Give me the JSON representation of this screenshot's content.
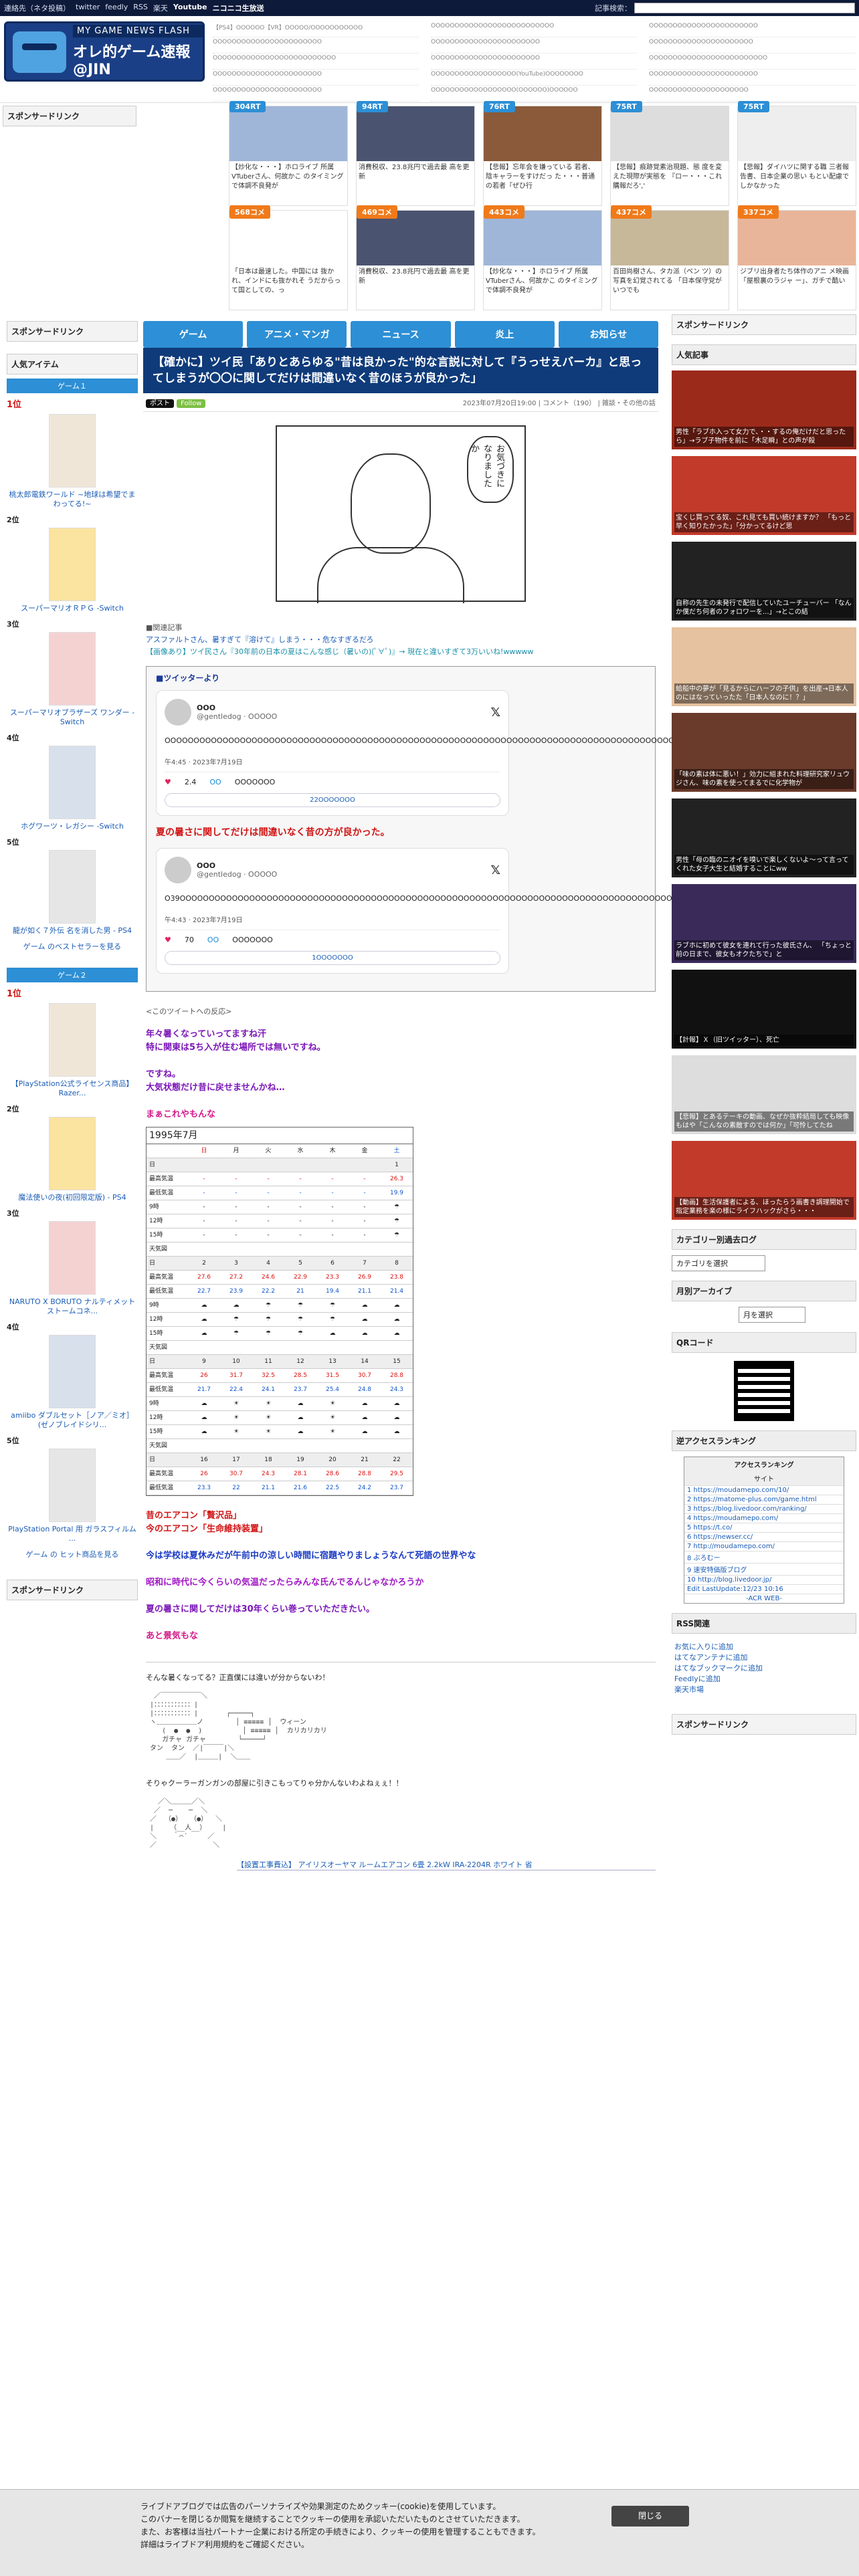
{
  "topbar": {
    "links": [
      "連絡先（ネタ投稿）",
      "twitter",
      "feedly",
      "RSS",
      "楽天",
      "Youtube",
      "ニコニコ生放送"
    ],
    "search_label": "記事検索："
  },
  "logo": {
    "line1": "MY GAME NEWS FLASH",
    "line2": "オレ的ゲーム速報@JIN"
  },
  "header_links": [
    "【PS4】OOOOOO【VR】OOOOO/OOOOOOOOOOO",
    "OOOOOOOOOOOOOOOOOOOOOOOOOO",
    "OOOOOOOOOOOOOOOOOOOOOOO",
    "OOOOOOOOOOOOOOOOOOOOOOO",
    "OOOOOOOOOOOOOOOOOOOOOOO",
    "OOOOOOOOOOOOOOOOOOOOOO",
    "OOOOOOOOOOOOOOOOOOOOOOOOOO",
    "OOOOOOOOOOOOOOOOOOOOOOO",
    "OOOOOOOOOOOOOOOOOOOOOOOOO",
    "OOOOOOOOOOOOOOOOOOOOOOO",
    "OOOOOOOOOOOOOOOOOO(YouTube)OOOOOOOO",
    "OOOOOOOOOOOOOOOOOOOOOOO",
    "OOOOOOOOOOOOOOOOOOOOOOO",
    "OOOOOOOOOOOOOOOOOO(OOOOOO)OOOOOO",
    "OOOOOOOOOOOOOOOOOOOOO"
  ],
  "sponsor": "スポンサードリンク",
  "hot": [
    {
      "tag": "304RT",
      "cap": "【炒化な・・・】ホロライブ 所属VTuberさん、何故かこ のタイミングで体調不良発が",
      "color": "#2d8fd5",
      "bg": "#9fb6d8"
    },
    {
      "tag": "94RT",
      "cap": "消費税収、23.8兆円で過去最 高を更新",
      "color": "#2d8fd5",
      "bg": "#4a5470"
    },
    {
      "tag": "76RT",
      "cap": "【悲報】忘年会を嫌っている 若者、陰キャラーをすけだっ た・・・普通の若者『ぜひ行",
      "color": "#2d8fd5",
      "bg": "#8b5a3a"
    },
    {
      "tag": "75RT",
      "cap": "【悲報】痕跡覚素治現題、態 度を変えた現際が実態を 『ロー・・・これ購報だろ','",
      "color": "#2d8fd5",
      "bg": "#ddd"
    },
    {
      "tag": "75RT",
      "cap": "【悲報】ダイハツに関する職 三者報告書、日本企業の思い もとい配慮でしかなかった",
      "color": "#2d8fd5",
      "bg": "#eee"
    },
    {
      "tag": "568コメ",
      "cap": "「日本は最速した。中国には 抜かれ、インドにも抜かれそ うだからって国としての、っ",
      "color": "#f07a1a",
      "bg": "#fff"
    },
    {
      "tag": "469コメ",
      "cap": "消費税収、23.8兆円で過去最 高を更新",
      "color": "#f07a1a",
      "bg": "#4a5470"
    },
    {
      "tag": "443コメ",
      "cap": "【炒化な・・・】ホロライブ 所属VTuberさん、何故かこ のタイミングで体調不良発が",
      "color": "#f07a1a",
      "bg": "#9fb6d8"
    },
    {
      "tag": "437コメ",
      "cap": "百田尚樹さん、タカ派（ペン ツ）の写真を幻覚されてる 「日本保守党がいつでも",
      "color": "#f07a1a",
      "bg": "#c8b89a"
    },
    {
      "tag": "337コメ",
      "cap": "ジブリ出身者たち体作のアニ メ映画「屋根裏のラジャ ー」、ガチで酷い",
      "color": "#f07a1a",
      "bg": "#e9b59a"
    }
  ],
  "nav": [
    "ゲーム",
    "アニメ・マンガ",
    "ニュース",
    "炎上",
    "お知らせ"
  ],
  "article": {
    "title": "【確かに】ツイ民「ありとあらゆる\"昔は良かった\"的な言説に対して『うっせえバーカ』と思ってしまうが〇〇に関してだけは間違いなく昔のほうが良かった」",
    "x_label": "ポスト",
    "follow_label": "Follow",
    "meta": "2023年07月20日19:00 | コメント（190） | 雑談・その他の話",
    "manga_text": "お気づきになりましたか",
    "related_head": "■関連記事",
    "related": [
      "アスファルトさん、暑すぎて『溶けて』しまう・・・危なすぎるだろ",
      "【画像あり】ツイ民さん『30年前の日本の夏はこんな感じ（暑いの)(ﾟ∀ﾟ)』→ 現在と違いすぎて3万いいね!wwwww"
    ],
    "twitter_head": "■ツイッターより",
    "tweets": [
      {
        "name": "OOO",
        "handle": "@gentledog · OOOOO",
        "text": "OOOOOOOOOOOOOOOOOOOOOOOOOOOOOOOOOOOOOOOOOOOOOOOOOOOOOOOOOOOOOOOOOOOOOOOOOOOOOOOOOOOOOOOOOOOOOOOOOOOOOOOOOOOOOOOOOOOOO",
        "time": "午4:45 · 2023年7月19日",
        "likes": "2.4",
        "reply": "OO",
        "link": "OOOOOOO",
        "more": "22OOOOOOO"
      },
      {
        "name": "OOO",
        "handle": "@gentledog · OOOOO",
        "text": "O39OOOOOOOOOOOOOOOOOOOOOOOOOOOOOOOOOOOOOOOOOOOOOOOOOOOOOOOOOOOOOOOOOOOOOOOOOOOOOOOOOOOOOOOOOOOOOOOOOOOOOOOOOOOOOO",
        "time": "午4:43 · 2023年7月19日",
        "likes": "70",
        "reply": "OO",
        "link": "OOOOOOO",
        "more": "1OOOOOOO"
      }
    ],
    "quote": "夏の暑さに関してだけは間違いなく昔の方が良かった。",
    "response_head": "<このツイートへの反応>",
    "resp1": "年々暑くなっていってますね汗\n特に関東は5ち入が住む場所では無いですね。",
    "resp2": "ですね。\n大気状態だけ昔に戻せませんかね…",
    "resp3": "まぁこれやもんな",
    "weather_caption": "1995年7月",
    "weather_days": [
      "日",
      "月",
      "火",
      "水",
      "木",
      "金",
      "土"
    ],
    "resp4": "昔のエアコン「贅沢品」\n今のエアコン「生命維持装置」",
    "resp5": "今は学校は夏休みだが午前中の涼しい時間に宿題やりましょうなんて死語の世界やな",
    "resp6": "昭和に時代に今くらいの気温だったらみんな氏んでるんじゃなかろうか",
    "resp7": "夏の暑さに関してだけは30年くらい巻っていただきたい。",
    "resp8": "あと景気もな",
    "aa1_head": "そんな暑くなってる？正直僕には違いが分からないわ！",
    "aa2_head": "そりゃクーラーガンガンの部屋に引きこもってりゃ分かんないわよねぇぇ！！",
    "promo": "【設置工事費込】 アイリスオーヤマ ルームエアコン 6畳 2.2kW IRA-2204R ホワイト 省"
  },
  "left": {
    "popular": "人気アイテム",
    "game1": "ゲーム１",
    "game2": "ゲーム２",
    "first": "1位",
    "items1": [
      {
        "rank": "",
        "t": "桃太郎電鉄ワールド ~地球は希望でまわってる!~"
      },
      {
        "rank": "2位",
        "t": "スーパーマリオＲＰＧ -Switch"
      },
      {
        "rank": "3位",
        "t": "スーパーマリオブラザーズ ワンダー -Switch"
      },
      {
        "rank": "4位",
        "t": "ホグワーツ・レガシー -Switch"
      },
      {
        "rank": "5位",
        "t": "龍が如く７外伝 名を消した男 - PS4"
      }
    ],
    "best1": "ゲーム のベストセラーを見る",
    "items2": [
      {
        "rank": "",
        "t": "【PlayStation公式ライセンス商品】Razer..."
      },
      {
        "rank": "2位",
        "t": "魔法使いの夜(初回限定版) - PS4"
      },
      {
        "rank": "3位",
        "t": "NARUTO X BORUTO ナルティメットストームコネ..."
      },
      {
        "rank": "4位",
        "t": "amiibo ダブルセット［ノア／ミオ］(ゼノブレイドシリ..."
      },
      {
        "rank": "5位",
        "t": "PlayStation Portal 用 ガラスフィルム ..."
      }
    ],
    "best2": "ゲーム の ヒット商品を見る"
  },
  "right": {
    "popular": "人気記事",
    "arts": [
      {
        "cap": "男性「ラブホ入って女力で、・・するの俺だけだと思ったら」→ラブ子物件を前に「木足瞬」との声が殺",
        "bg": "#9c2a1a"
      },
      {
        "cap": "宝くじ買ってる奴、これ見ても買い続けますか？ 「もっと早く知りたかった」「分かってるけど思",
        "bg": "#c23a2a"
      },
      {
        "cap": "自称の先生の未発行で配信していたユーチューバー 「なんか僕だち何者のフォロワーを...」→とこの結",
        "bg": "#222"
      },
      {
        "cap": "給船中の夢が「見るからにハーフの子供」を出産→日本人のにはなっていったた「日本人なのに！？」",
        "bg": "#e6c2a0"
      },
      {
        "cap": "「味の素は体に悪い！」効力に組まれた料理研究家リュウジさん、味の素を使ってまるでに化学物が",
        "bg": "#6a3a2a"
      },
      {
        "cap": "男性「母の臨のニオイを嗅いで楽しくないよ～って言ってくれた女子大生と結婚することにww",
        "bg": "#222"
      },
      {
        "cap": "ラブホに初めて彼女を連れて行った彼氏さん、 「ちょっと前の日まで、彼女もオクたちで」と",
        "bg": "#3a2a5a"
      },
      {
        "cap": "【計報】Ｘ（旧ツイッター）、死亡",
        "bg": "#111"
      },
      {
        "cap": "【悲報】とあるテーキの動画、なぜか抜粋結局しても映像 もはや「こんなの素敵すのでは何か」「可怜してたね",
        "bg": "#ddd"
      },
      {
        "cap": "【動画】生活保護者による、ほったらう画書き調理開始で指定業務を楽の様にライフハックがさら・・・",
        "bg": "#c23a2a"
      }
    ],
    "cat_head": "カテゴリー別過去ログ",
    "cat_sel": "カテゴリを選択",
    "month_head": "月別アーカイブ",
    "month_sel": "月を選択",
    "qr_head": "QRコード",
    "acc_head": "逆アクセスランキング",
    "acc_title": "アクセスランキング",
    "acc_sub": "サイト",
    "acc_rows": [
      "1 https://moudamepo.com/10/",
      "2 https://matome-plus.com/game.html",
      "3 https://blog.livedoor.com/ranking/",
      "4 https://moudamepo.com/",
      "5 https://t.co/",
      "6 https://newser.cc/",
      "7 http://moudamepo.com/",
      "8 ぶろむー",
      "9 速安特価版ブログ",
      "10 http://blog.livedoor.jp/"
    ],
    "acc_foot": "Edit LastUpdate:12/23 10:16",
    "acc_foot2": "-ACR WEB-",
    "rss_head": "RSS関連",
    "rss": [
      "お気に入りに追加",
      "はてなアンテナに追加",
      "はてなブックマークに追加",
      "Feedlyに追加",
      "楽天市場"
    ]
  },
  "cookie": {
    "text": "ライブドアブログでは広告のパーソナライズや効果測定のためクッキー(cookie)を使用しています。\nこのバナーを閉じるか閲覧を継続することでクッキーの使用を承認いただいたものとさせていただきます。\nまた、お客様は当社パートナー企業における所定の手続きにより、クッキーの使用を管理することもできます。\n詳細はライブドア利用規約をご確認ください。",
    "close": "閉じる"
  }
}
